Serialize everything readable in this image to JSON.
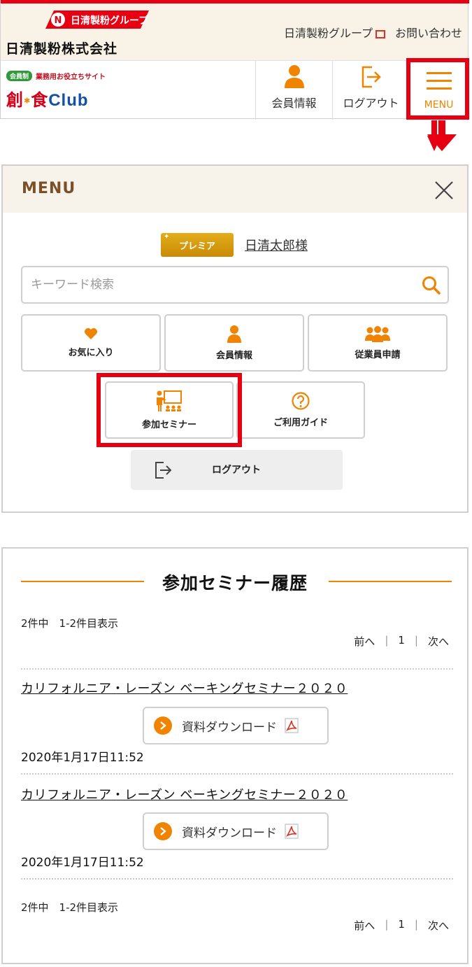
{
  "header": {
    "logo_banner_text": "日清製粉グループ",
    "corp_name": "日清製粉株式会社",
    "link_group": "日清製粉グループ",
    "link_contact": "お問い合わせ",
    "site_badge": "会員制",
    "site_badge_text": "業務用お役立ちサイト",
    "site_logo_main": "創",
    "site_logo_mid": "食",
    "site_logo_club": "Club",
    "nav_member": "会員情報",
    "nav_logout": "ログアウト",
    "nav_menu": "MENU",
    "icons": {
      "member": "person-icon",
      "logout": "logout-icon",
      "menu": "hamburger-icon",
      "external": "external-link-icon"
    }
  },
  "menu": {
    "title": "MENU",
    "premium_label": "プレミア",
    "user_name": "日清太郎様",
    "search_placeholder": "キーワード検索",
    "tiles": [
      {
        "label": "お気に入り",
        "icon": "heart-icon"
      },
      {
        "label": "会員情報",
        "icon": "person-icon"
      },
      {
        "label": "従業員申請",
        "icon": "group-icon"
      },
      {
        "label": "参加セミナー",
        "icon": "seminar-icon"
      },
      {
        "label": "ご利用ガイド",
        "icon": "question-icon"
      }
    ],
    "logout_label": "ログアウト"
  },
  "history": {
    "title": "参加セミナー履歴",
    "count_text": "2件中　1-2件目表示",
    "pager": {
      "prev": "前へ",
      "sep": "|",
      "page": "1",
      "next": "次へ"
    },
    "items": [
      {
        "title": "カリフォルニア・レーズン ベーキングセミナー２０２０",
        "download_label": "資料ダウンロード",
        "date": "2020年1月17日11:52"
      },
      {
        "title": "カリフォルニア・レーズン ベーキングセミナー２０２０",
        "download_label": "資料ダウンロード",
        "date": "2020年1月17日11:52"
      }
    ]
  },
  "colors": {
    "accent": "#f08300",
    "highlight": "#e60012",
    "brand_brown": "#7a5028",
    "premium_gold": "#d69a0f"
  }
}
